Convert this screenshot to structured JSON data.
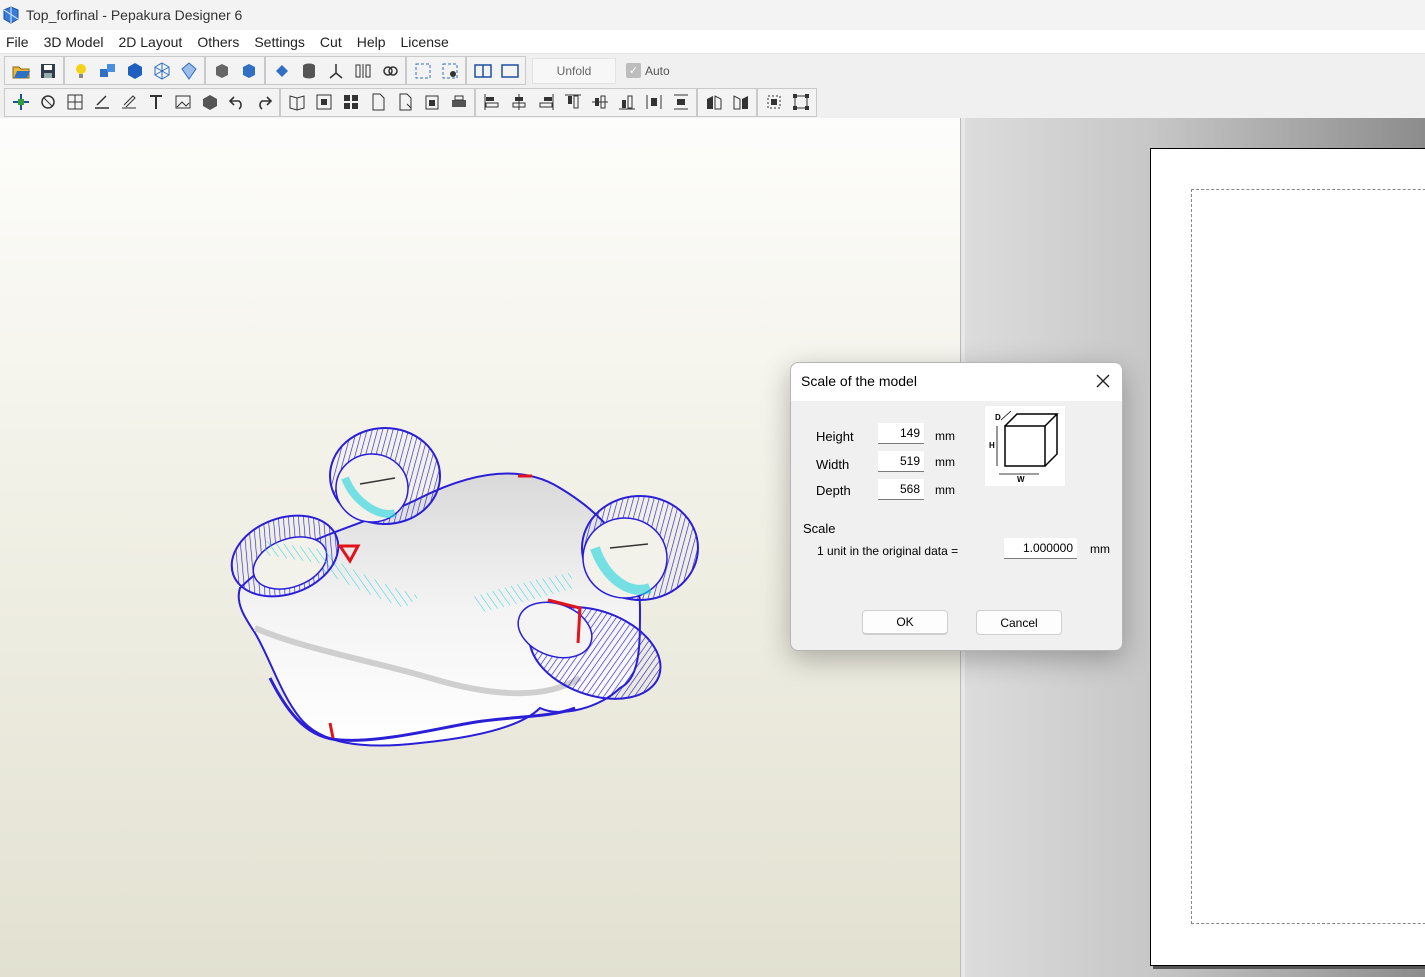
{
  "window": {
    "title": "Top_forfinal - Pepakura Designer 6"
  },
  "menu": [
    "File",
    "3D Model",
    "2D Layout",
    "Others",
    "Settings",
    "Cut",
    "Help",
    "License"
  ],
  "toolbar": {
    "unfold_label": "Unfold",
    "auto_label": "Auto",
    "auto_checked": true
  },
  "dialog": {
    "title": "Scale of the model",
    "height_label": "Height",
    "height_value": "149",
    "width_label": "Width",
    "width_value": "519",
    "depth_label": "Depth",
    "depth_value": "568",
    "unit_mm": "mm",
    "scale_label": "Scale",
    "scale_text": "1 unit in the original data =",
    "scale_value": "1.000000",
    "ok_label": "OK",
    "cancel_label": "Cancel",
    "diagram_labels": {
      "d": "D",
      "h": "H",
      "w": "W"
    }
  },
  "colors": {
    "model_edge": "#2a1fd6",
    "fold_line": "#22d6e0",
    "cut_line": "#e0141a"
  }
}
